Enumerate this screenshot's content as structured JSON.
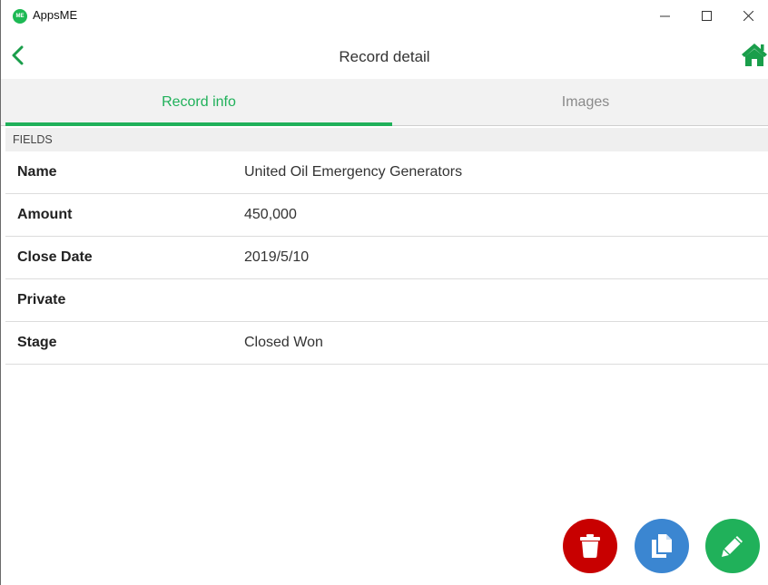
{
  "window": {
    "title": "AppsME",
    "logo_text": "ME"
  },
  "navbar": {
    "title": "Record detail",
    "back_icon": "chevron-left-icon",
    "home_icon": "home-icon"
  },
  "tabs": [
    {
      "label": "Record info",
      "active": true
    },
    {
      "label": "Images",
      "active": false
    }
  ],
  "section": {
    "header": "FIELDS"
  },
  "fields": [
    {
      "label": "Name",
      "value": "United Oil Emergency Generators"
    },
    {
      "label": "Amount",
      "value": "450,000"
    },
    {
      "label": "Close Date",
      "value": "2019/5/10"
    },
    {
      "label": "Private",
      "value": ""
    },
    {
      "label": "Stage",
      "value": "Closed Won"
    }
  ],
  "actions": {
    "delete_icon": "trash-icon",
    "copy_icon": "copy-icon",
    "edit_icon": "pencil-icon"
  },
  "colors": {
    "accent": "#20b15a",
    "delete": "#c80000",
    "copy": "#3b86d1",
    "edit": "#20b15a"
  }
}
